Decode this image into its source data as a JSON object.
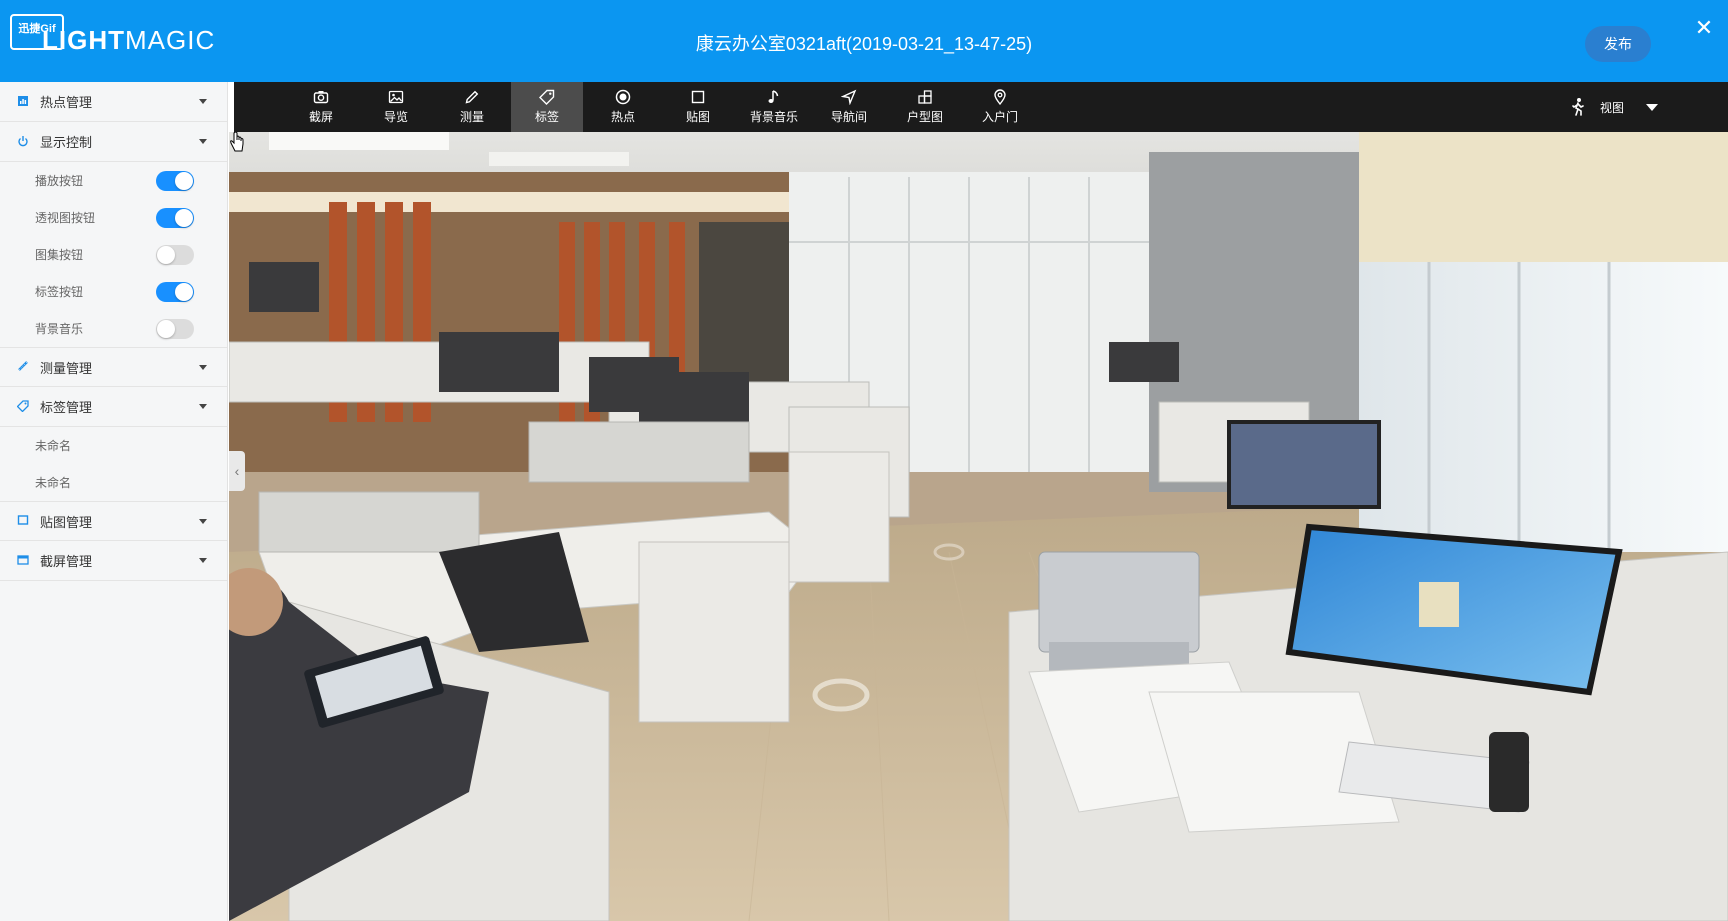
{
  "header": {
    "logo_badge": "迅捷Gif",
    "logo_bold": "LIGHT",
    "logo_light": "MAGIC",
    "title": "康云办公室0321aft(2019-03-21_13-47-25)",
    "publish_label": "发布",
    "close_label": "✕",
    "accent_color": "#0b96f1"
  },
  "sidebar": {
    "sections": [
      {
        "label": "热点管理",
        "icon": "bar-chart-icon"
      },
      {
        "label": "显示控制",
        "icon": "power-icon"
      },
      {
        "label": "测量管理",
        "icon": "ruler-icon"
      },
      {
        "label": "标签管理",
        "icon": "tag-icon"
      },
      {
        "label": "贴图管理",
        "icon": "square-icon"
      },
      {
        "label": "截屏管理",
        "icon": "screenshot-icon"
      }
    ],
    "display_controls": [
      {
        "label": "播放按钮",
        "on": true
      },
      {
        "label": "透视图按钮",
        "on": true
      },
      {
        "label": "图集按钮",
        "on": false
      },
      {
        "label": "标签按钮",
        "on": true
      },
      {
        "label": "背景音乐",
        "on": false
      }
    ],
    "tags": [
      {
        "label": "未命名"
      },
      {
        "label": "未命名"
      }
    ],
    "collapse_label": "‹"
  },
  "toolbar": {
    "tools": [
      {
        "label": "截屏",
        "icon": "camera-icon",
        "active": false
      },
      {
        "label": "导览",
        "icon": "image-icon",
        "active": false
      },
      {
        "label": "测量",
        "icon": "pencil-icon",
        "active": false
      },
      {
        "label": "标签",
        "icon": "tag-icon",
        "active": true
      },
      {
        "label": "热点",
        "icon": "hotspot-icon",
        "active": false
      },
      {
        "label": "贴图",
        "icon": "square-icon",
        "active": false
      },
      {
        "label": "背景音乐",
        "icon": "music-note-icon",
        "active": false
      },
      {
        "label": "导航间",
        "icon": "navigation-arrow-icon",
        "active": false
      },
      {
        "label": "户型图",
        "icon": "floorplan-icon",
        "active": false
      },
      {
        "label": "入户门",
        "icon": "location-pin-icon",
        "active": false
      }
    ],
    "view_label": "视图",
    "view_icon": "walking-person-icon"
  }
}
